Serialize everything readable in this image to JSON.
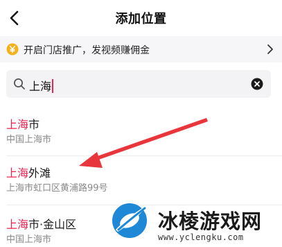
{
  "header": {
    "title": "添加位置",
    "back_icon": "chevron-left-icon"
  },
  "promo": {
    "icon": "yen-coin-icon",
    "text": "开启门店推广，发视频赚佣金",
    "chevron_icon": "chevron-right-icon"
  },
  "search": {
    "value": "上海",
    "search_icon": "search-icon",
    "clear_icon": "clear-icon"
  },
  "results": [
    {
      "highlight": "上海",
      "rest": "市",
      "address": "中国上海市"
    },
    {
      "highlight": "上海",
      "rest": "外滩",
      "address": "上海市虹口区黄浦路99号"
    },
    {
      "highlight": "上海",
      "rest": "市·金山区",
      "address": "中国上海市"
    }
  ],
  "watermark": {
    "title": "冰棱游戏网",
    "url": "www.yclengku.com"
  },
  "colors": {
    "highlight": "#f0224e",
    "arrow": "#e8363c",
    "promo_background": "#f6f6f8",
    "search_background": "#f3f3f5",
    "coin": "#f3b21c"
  }
}
